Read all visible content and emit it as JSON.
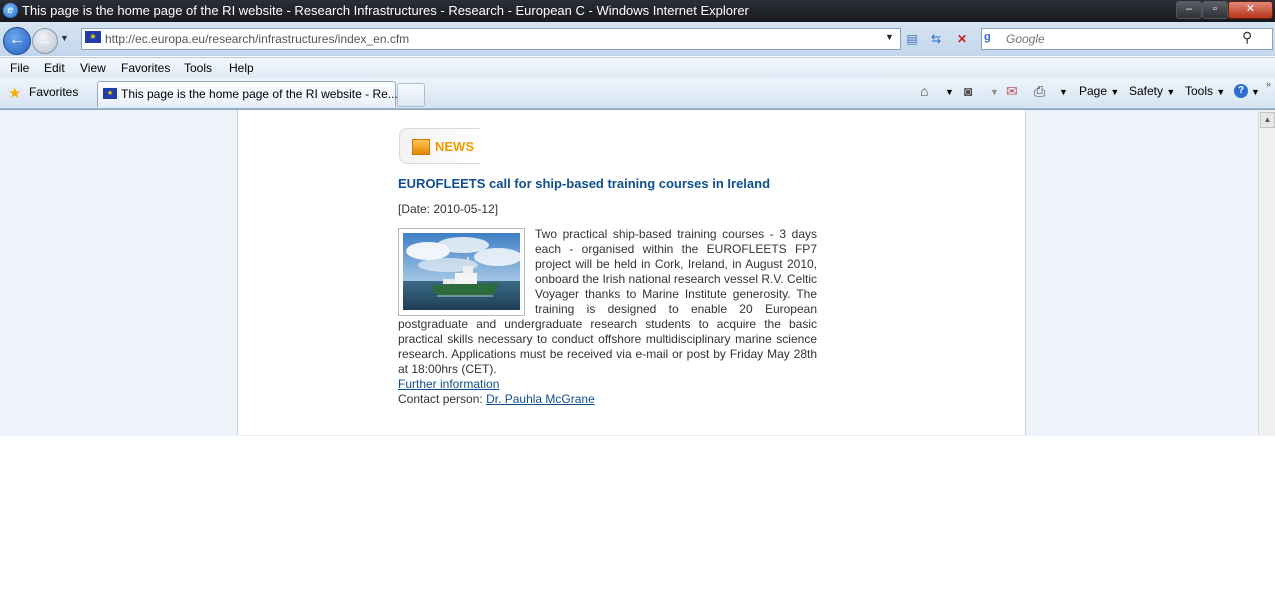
{
  "window": {
    "title": "This page is the home page of the RI website - Research Infrastructures - Research - European C - Windows Internet Explorer"
  },
  "address": {
    "url": "http://ec.europa.eu/research/infrastructures/index_en.cfm",
    "search_placeholder": "Google"
  },
  "menu": {
    "items": [
      "File",
      "Edit",
      "View",
      "Favorites",
      "Tools",
      "Help"
    ]
  },
  "tabs": {
    "favorites_label": "Favorites",
    "active_tab_label": "This page is the home page of the RI website - Re..."
  },
  "command_bar": {
    "page": "Page",
    "safety": "Safety",
    "tools": "Tools"
  },
  "content": {
    "news_heading": "NEWS",
    "article_title": "EUROFLEETS call for ship-based training courses in Ireland",
    "date": "[Date: 2010-05-12]",
    "body": "Two practical ship-based training courses - 3 days each - organised within the EUROFLEETS FP7 project will be held in Cork, Ireland, in August 2010, onboard the Irish national research vessel R.V. Celtic Voyager thanks to Marine Institute generosity. The training is designed to enable 20 European postgraduate and undergraduate research students to acquire the basic practical skills necessary to conduct offshore multidisciplinary marine science research. Applications must be received via e-mail or post by Friday May 28th at 18:00hrs (CET).",
    "further_link": "Further information",
    "contact_label": "Contact person:",
    "contact_name": "Dr. Pauhla McGrane"
  }
}
